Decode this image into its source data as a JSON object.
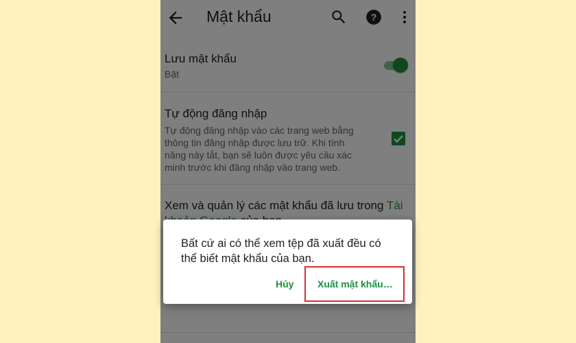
{
  "appbar": {
    "title": "Mật khẩu",
    "icons": [
      "back-arrow-icon",
      "search-icon",
      "help-icon",
      "more-vert-icon"
    ]
  },
  "settings": {
    "save_passwords": {
      "label": "Lưu mật khẩu",
      "status": "Bật",
      "toggle_on": true
    },
    "auto_signin": {
      "label": "Tự động đăng nhập",
      "description_lines": [
        "Tự động đăng nhập vào các trang web bằng",
        "thông tin đăng nhập được lưu trữ. Khi tính",
        "năng này tắt, bạn sẽ luôn được yêu cầu xác",
        "minh trước khi đăng nhập vào trang web."
      ],
      "checked": true
    },
    "manage": {
      "line1_text": "Xem và quản lý các mật khẩu đã lưu trong ",
      "line1_link": "Tài",
      "line2_link": "khoản Google",
      "line2_text": " của bạn"
    }
  },
  "dialog": {
    "message_lines": [
      "Bất cứ ai có thể xem tệp đã xuất đều có",
      "thể biết mật khẩu của bạn."
    ],
    "cancel_label": "Hủy",
    "export_label": "Xuất mật khẩu…"
  },
  "colors": {
    "accent": "#1e8e3e",
    "highlight_border": "#d32f2f",
    "background": "#fff2bf"
  }
}
